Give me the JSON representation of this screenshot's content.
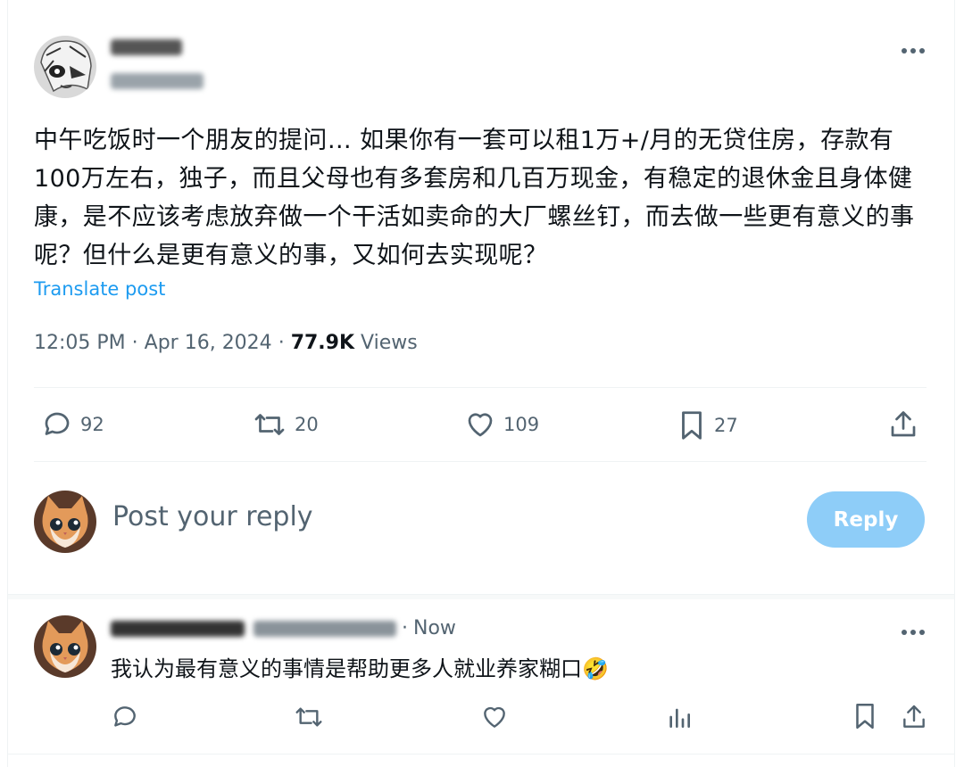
{
  "post": {
    "text": "中午吃饭时一个朋友的提问… 如果你有一套可以租1万+/月的无贷住房，存款有100万左右，独子，而且父母也有多套房和几百万现金，有稳定的退休金且身体健康，是不应该考虑放弃做一个干活如卖命的大厂螺丝钉，而去做一些更有意义的事呢？但什么是更有意义的事，又如何去实现呢？",
    "translate_label": "Translate post",
    "time": "12:05 PM",
    "sep1": "·",
    "date": "Apr 16, 2024",
    "sep2": "·",
    "views_count": "77.9K",
    "views_label": "Views",
    "actions": {
      "replies": "92",
      "reposts": "20",
      "likes": "109",
      "bookmarks": "27"
    }
  },
  "composer": {
    "placeholder": "Post your reply",
    "button_label": "Reply",
    "button_color": "#8ecdf8"
  },
  "reply": {
    "time_sep": "·",
    "time": "Now",
    "text": "我认为最有意义的事情是帮助更多人就业养家糊口🤣"
  },
  "colors": {
    "accent": "#1d9bf0",
    "secondary_text": "#536471",
    "divider": "#eff3f4"
  }
}
